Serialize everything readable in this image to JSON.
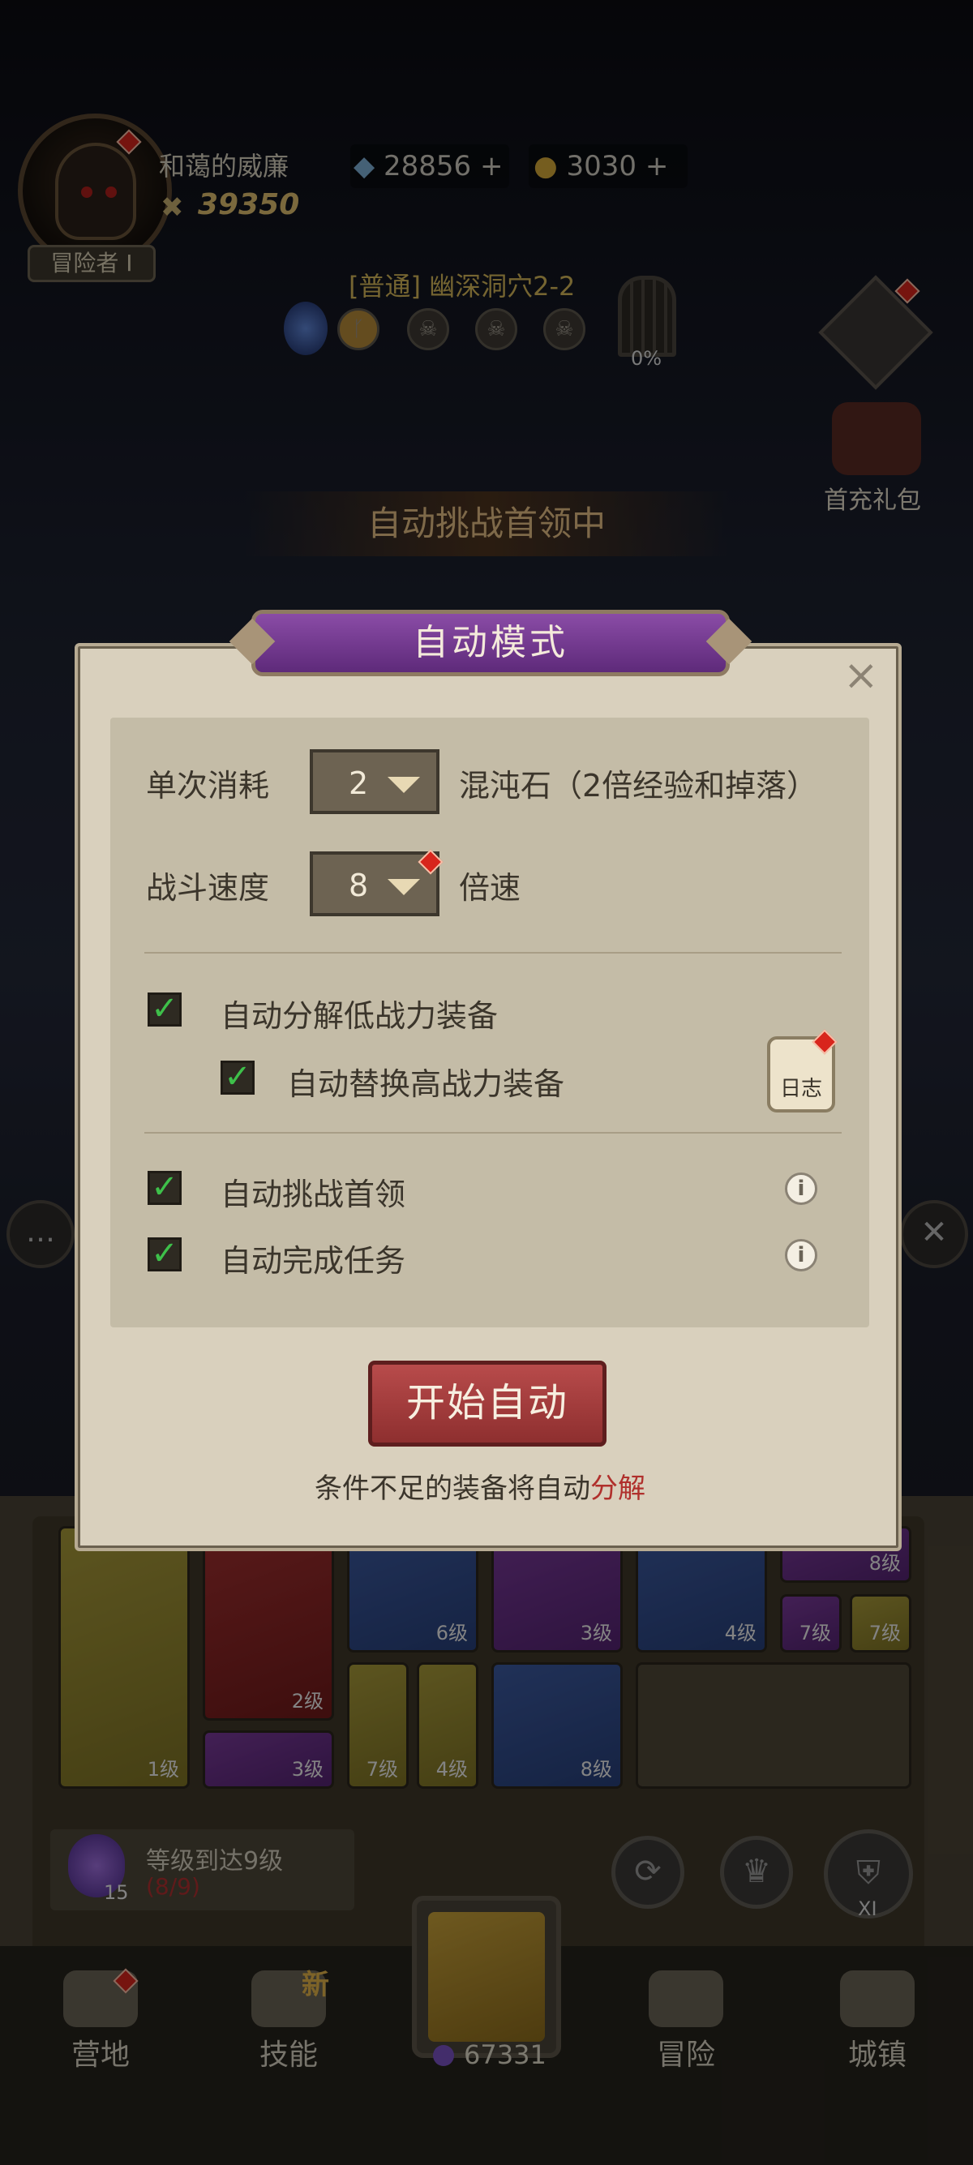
{
  "player": {
    "name": "和蔼的威廉",
    "power": "39350",
    "rank": "冒险者 I"
  },
  "currency": {
    "gems": "28856",
    "coins": "3030"
  },
  "stage": {
    "title": "[普通] 幽深洞穴2-2",
    "progress": "0%"
  },
  "gift": {
    "label": "首充礼包"
  },
  "auto_banner": "自动挑战首领中",
  "modal": {
    "title": "自动模式",
    "close": "×",
    "consume_label": "单次消耗",
    "consume_value": "2",
    "consume_suffix": "混沌石（2倍经验和掉落）",
    "speed_label": "战斗速度",
    "speed_value": "8",
    "speed_suffix": "倍速",
    "options": {
      "auto_dismantle": "自动分解低战力装备",
      "auto_replace": "自动替换高战力装备",
      "auto_boss": "自动挑战首领",
      "auto_task": "自动完成任务"
    },
    "log_label": "日志",
    "start_button": "开始自动",
    "note_prefix": "条件不足的装备将自动",
    "note_highlight": "分解"
  },
  "inventory": {
    "slots": [
      {
        "level": "1级"
      },
      {
        "level": "2级"
      },
      {
        "level": "6级"
      },
      {
        "level": "3级"
      },
      {
        "level": "4级"
      },
      {
        "level": "8级"
      },
      {
        "level": "7级"
      },
      {
        "level": "7级"
      },
      {
        "level": "3级"
      },
      {
        "level": "7级"
      },
      {
        "level": "4级"
      },
      {
        "level": "8级"
      }
    ]
  },
  "level_goal": {
    "text": "等级到达9级",
    "progress": "(8/9)",
    "count": "15"
  },
  "xi_label": "XI",
  "nav": {
    "camp": "营地",
    "skills": "技能",
    "new_tag": "新",
    "adventure": "冒险",
    "town": "城镇",
    "coin_amount": "67331"
  },
  "colors": {
    "accent_purple": "#6b3a8a",
    "start_button": "#a13c3c",
    "check_green": "#3ec04a"
  }
}
